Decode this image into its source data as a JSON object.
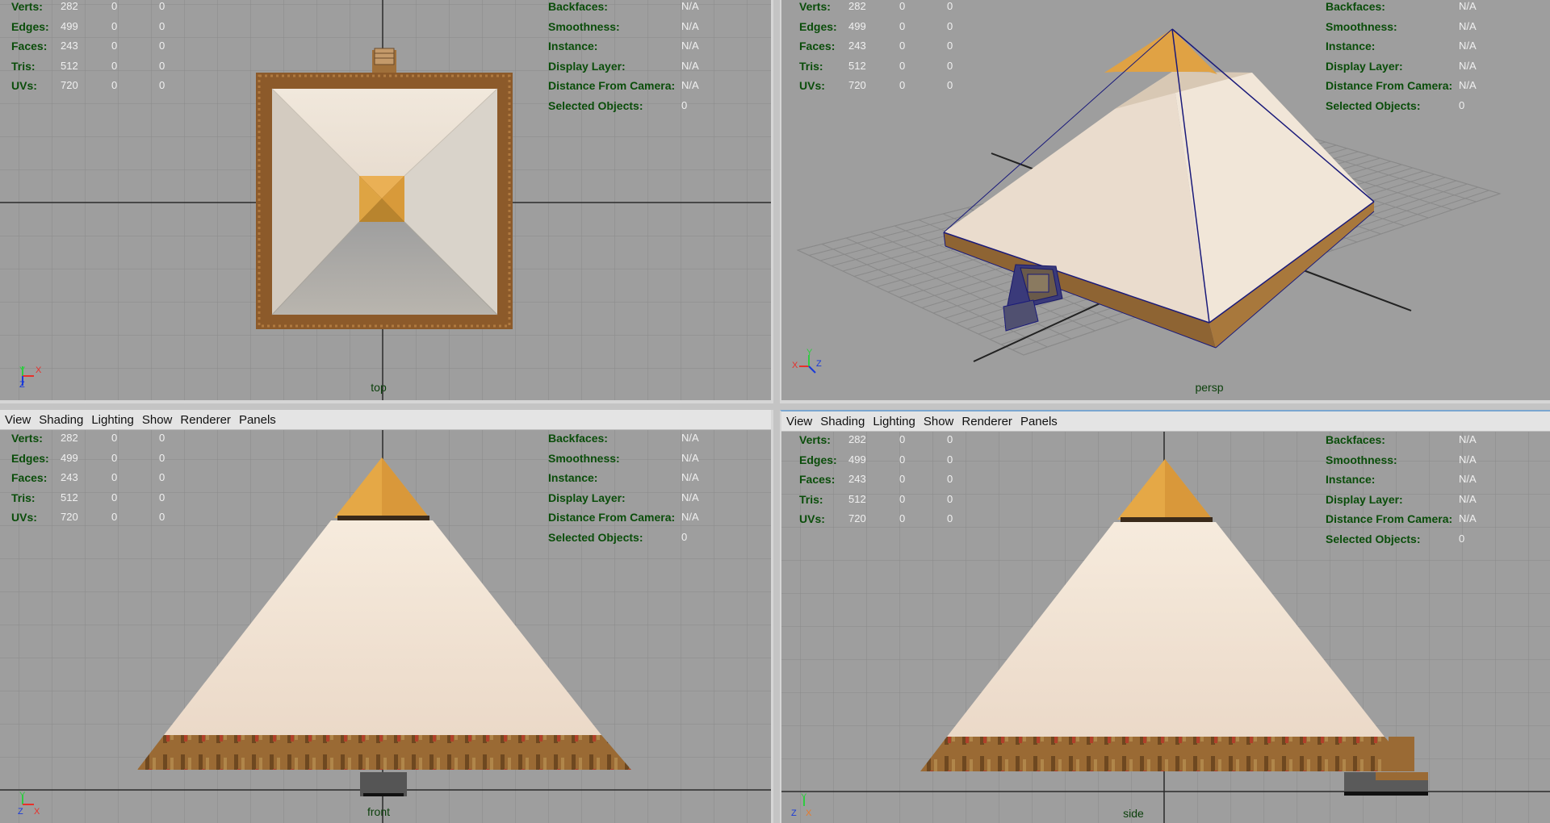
{
  "menu": [
    "View",
    "Shading",
    "Lighting",
    "Show",
    "Renderer",
    "Panels"
  ],
  "stats": [
    {
      "label": "Verts:",
      "values": [
        "282",
        "0",
        "0"
      ]
    },
    {
      "label": "Edges:",
      "values": [
        "499",
        "0",
        "0"
      ]
    },
    {
      "label": "Faces:",
      "values": [
        "243",
        "0",
        "0"
      ]
    },
    {
      "label": "Tris:",
      "values": [
        "512",
        "0",
        "0"
      ]
    },
    {
      "label": "UVs:",
      "values": [
        "720",
        "0",
        "0"
      ]
    }
  ],
  "info": [
    {
      "label": "Backfaces:",
      "value": "N/A"
    },
    {
      "label": "Smoothness:",
      "value": "N/A"
    },
    {
      "label": "Instance:",
      "value": "N/A"
    },
    {
      "label": "Display Layer:",
      "value": "N/A"
    },
    {
      "label": "Distance From Camera:",
      "value": "N/A"
    },
    {
      "label": "Selected Objects:",
      "value": "0"
    }
  ],
  "viewports": {
    "top": {
      "camera": "top",
      "axes": [
        "Y",
        "X",
        "Z"
      ]
    },
    "persp": {
      "camera": "persp",
      "axes": [
        "X",
        "Y",
        "Z"
      ]
    },
    "front": {
      "camera": "front",
      "axes": [
        "Y",
        "Z",
        "X"
      ]
    },
    "side": {
      "camera": "side",
      "axes": [
        "Y",
        "Z",
        "X"
      ]
    }
  },
  "colors": {
    "viewport_bg": "#9e9e9e",
    "grid": "#8a8a8a",
    "hud_label": "#0a4d0a",
    "hud_value": "#f0f0f0",
    "stone": "#eadfd0",
    "capstone": "#e5a846",
    "base_band": "#9a6a34",
    "selection": "#1a1a7a"
  }
}
